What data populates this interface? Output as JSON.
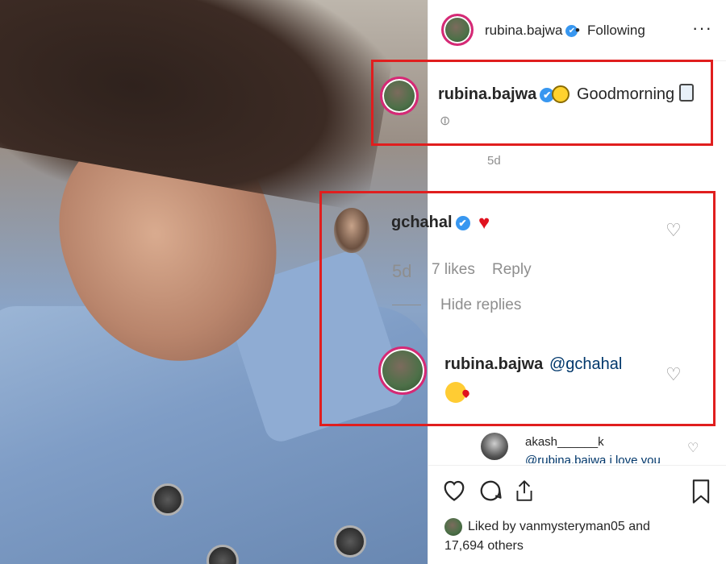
{
  "post": {
    "author": "rubina.bajwa",
    "follow_status": "Following",
    "separator": "•",
    "more": "···"
  },
  "caption": {
    "username": "rubina.bajwa",
    "text": "Goodmorning",
    "time": "5d"
  },
  "comment": {
    "username": "gchahal",
    "text": "♥",
    "time": "5d",
    "likes": "7 likes",
    "reply_label": "Reply",
    "hide_replies": "Hide replies"
  },
  "reply": {
    "username": "rubina.bajwa",
    "mention": "@gchahal"
  },
  "another_comment": {
    "username": "akash______k",
    "text": "@rubina.bajwa i love you"
  },
  "likes_summary": {
    "line1": "Liked by vanmysteryman05 and",
    "line2": "17,694 others"
  },
  "icons": {
    "like": "heart-icon",
    "comment": "comment-icon",
    "share": "share-icon",
    "save": "save-icon",
    "verified": "✔"
  },
  "colors": {
    "highlight": "#e01e1e",
    "verified": "#3897f0",
    "link": "#00376b"
  }
}
